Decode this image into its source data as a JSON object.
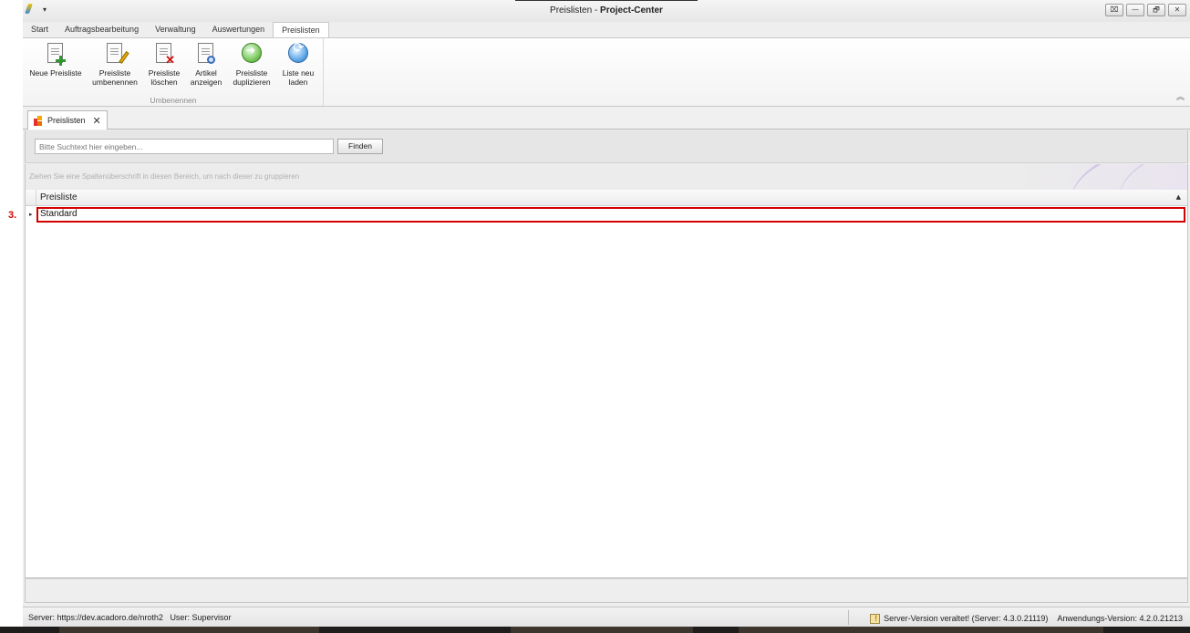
{
  "annotation": {
    "label": "3."
  },
  "window": {
    "title_part1": "Preislisten - ",
    "title_part2": "Project-Center",
    "qa_dropdown": "▾",
    "controls": [
      "⌧",
      "—",
      "🗗",
      "✕"
    ]
  },
  "ribbon_tabs": [
    "Start",
    "Auftragsbearbeitung",
    "Verwaltung",
    "Auswertungen",
    "Preislisten"
  ],
  "active_tab": "Preislisten",
  "ribbon": {
    "buttons": [
      {
        "line1": "Neue Preisliste",
        "line2": "",
        "icon": "new-document-icon"
      },
      {
        "line1": "Preisliste",
        "line2": "umbenennen",
        "icon": "rename-document-icon"
      },
      {
        "line1": "Preisliste",
        "line2": "löschen",
        "icon": "delete-document-icon"
      },
      {
        "line1": "Artikel",
        "line2": "anzeigen",
        "icon": "view-articles-icon"
      },
      {
        "line1": "Preisliste",
        "line2": "duplizieren",
        "icon": "duplicate-icon"
      },
      {
        "line1": "Liste neu",
        "line2": "laden",
        "icon": "reload-icon"
      }
    ],
    "group_label": "Umbenennen",
    "collapse_glyph": "︽"
  },
  "document_tab": {
    "label": "Preislisten",
    "close": "✕"
  },
  "search": {
    "placeholder": "Bitte Suchtext hier eingeben...",
    "button": "Finden"
  },
  "group_hint": "Ziehen Sie eine Spaltenüberschrift in diesen Bereich, um nach dieser zu gruppieren",
  "grid": {
    "column": "Preisliste",
    "sort_glyph": "▲",
    "row_indicator": "▸",
    "rows": [
      "Standard"
    ]
  },
  "status": {
    "server": "Server: https://dev.acadoro.de/nroth2",
    "user": "User: Supervisor",
    "warning": "Server-Version veraltet! (Server: 4.3.0.21119)",
    "app_version": "Anwendungs-Version: 4.2.0.21213"
  },
  "colors": {
    "highlight": "#d40000",
    "accent_green": "#2e9a2e",
    "delete_red": "#d01010"
  }
}
